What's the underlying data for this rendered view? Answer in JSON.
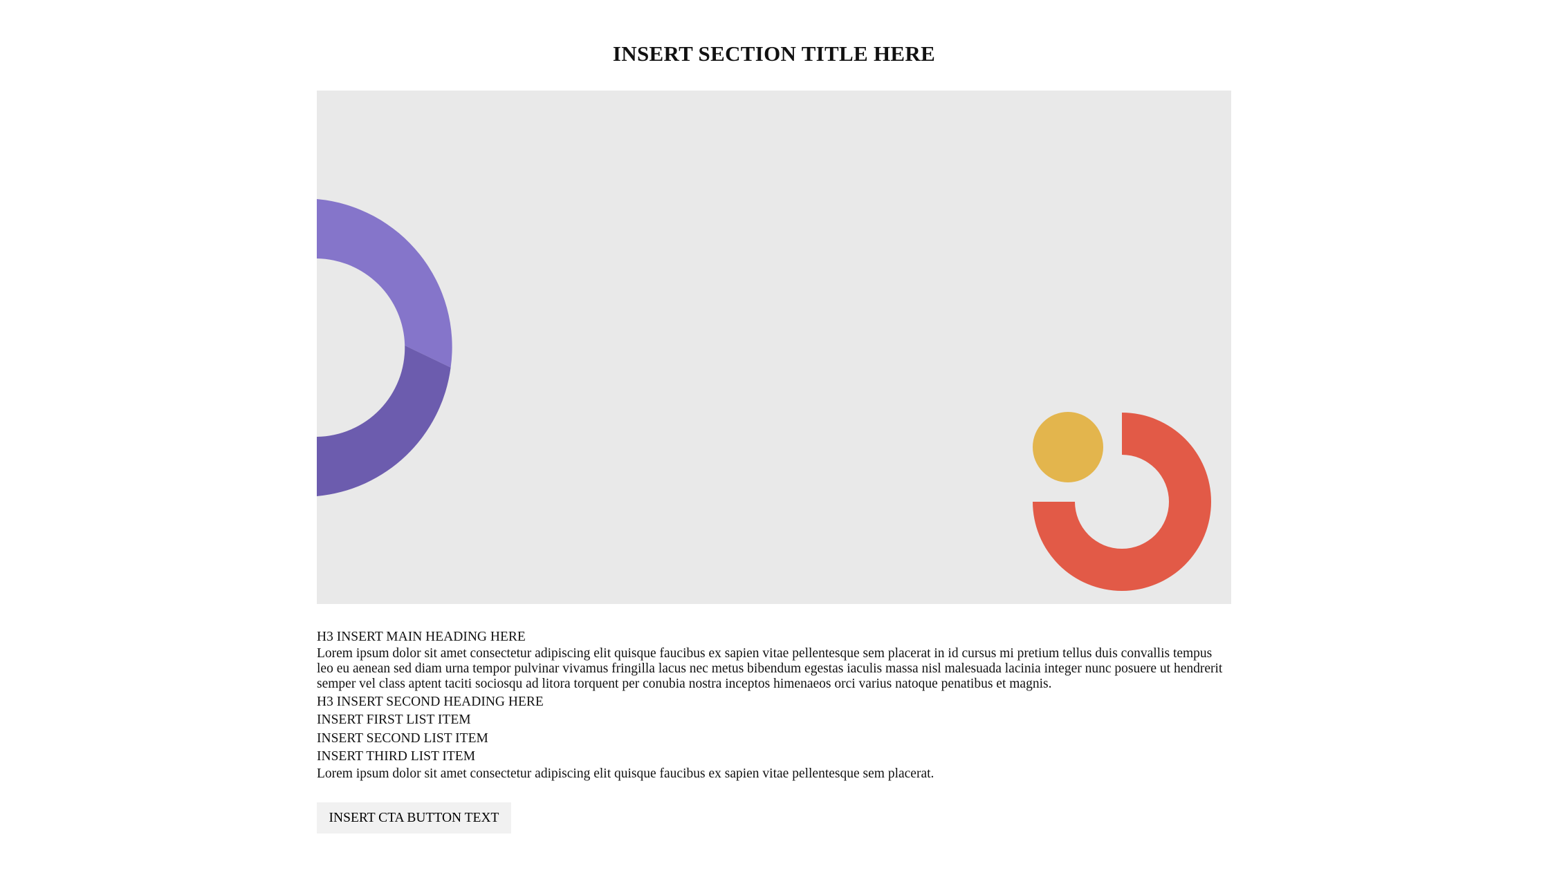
{
  "section": {
    "title": "INSERT SECTION TITLE HERE"
  },
  "hero": {
    "shapes": [
      {
        "name": "purple-donut-decoration",
        "colors": [
          "#8575ca",
          "#6c5cae"
        ]
      },
      {
        "name": "yellow-circle-decoration",
        "color": "#e3b54d"
      },
      {
        "name": "red-ring-decoration",
        "color": "#e25a47"
      }
    ]
  },
  "content": {
    "heading_main": "H3 INSERT MAIN HEADING HERE",
    "paragraph_1": "Lorem ipsum dolor sit amet consectetur adipiscing elit quisque faucibus ex sapien vitae pellentesque sem placerat in id cursus mi pretium tellus duis convallis tempus leo eu aenean sed diam urna tempor pulvinar vivamus fringilla lacus nec metus bibendum egestas iaculis massa nisl malesuada lacinia integer nunc posuere ut hendrerit semper vel class aptent taciti sociosqu ad litora torquent per conubia nostra inceptos himenaeos orci varius natoque penatibus et magnis.",
    "heading_second": "H3 INSERT SECOND HEADING HERE",
    "list_items": [
      "INSERT FIRST LIST ITEM",
      "INSERT SECOND LIST ITEM",
      "INSERT THIRD LIST ITEM"
    ],
    "paragraph_2": "Lorem ipsum dolor sit amet consectetur adipiscing elit quisque faucibus ex sapien vitae pellentesque sem placerat."
  },
  "cta": {
    "label": "INSERT CTA BUTTON TEXT"
  }
}
